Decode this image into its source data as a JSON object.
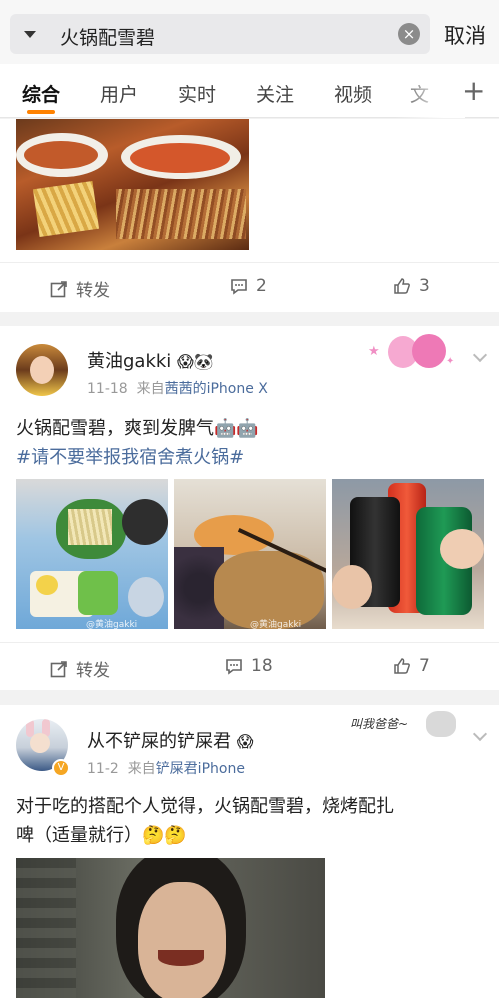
{
  "search": {
    "query": "火锅配雪碧",
    "cancel_label": "取消"
  },
  "tabs": [
    "综合",
    "用户",
    "实时",
    "关注",
    "视频",
    "文"
  ],
  "post0": {
    "repost_label": "转发",
    "comment_count": "2",
    "like_count": "3"
  },
  "post1": {
    "username": "黄油gakki",
    "emoji": "😱🐼",
    "date": "11-18",
    "source_prefix": "来自",
    "source": "茜茜的iPhone X",
    "text": "火锅配雪碧，爽到发脾气",
    "text_emoji": "🤖🤖",
    "hashtag": "#请不要举报我宿舍煮火锅#",
    "repost_label": "转发",
    "comment_count": "18",
    "like_count": "7",
    "watermark1": "@黄油gakki",
    "watermark2": "@黄油gakki"
  },
  "post2": {
    "username": "从不铲屎的铲屎君",
    "emoji": "😱",
    "date": "11-2",
    "source_prefix": "来自",
    "source": "铲屎君iPhone",
    "text_line1": "对于吃的搭配个人觉得，火锅配雪碧，烧烤配扎",
    "text_line2": "啤（适量就行）",
    "text_emoji": "🤔🤔",
    "sticker": "叫我爸爸~"
  },
  "colors": {
    "accent": "#ff8200",
    "link": "#4b6c9c"
  }
}
